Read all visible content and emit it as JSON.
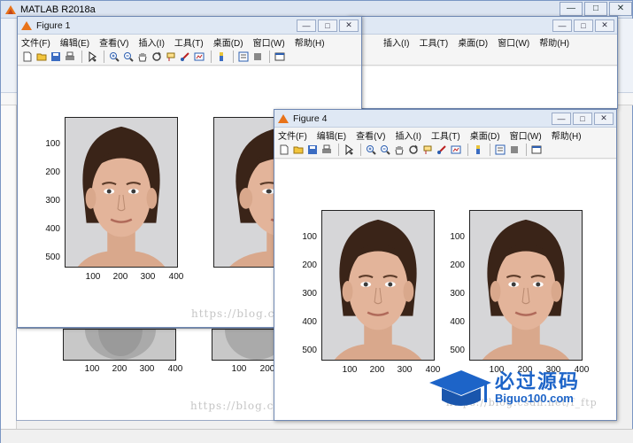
{
  "matlab": {
    "title": "MATLAB R2018a",
    "controls": {
      "minimize": "—",
      "maximize": "□",
      "close": "✕"
    }
  },
  "figures": [
    {
      "id": "figure1",
      "title": "Figure 1",
      "menus": [
        "文件(F)",
        "编辑(E)",
        "查看(V)",
        "插入(I)",
        "工具(T)",
        "桌面(D)",
        "窗口(W)",
        "帮助(H)"
      ],
      "y_ticks": [
        "100",
        "200",
        "300",
        "400",
        "500"
      ],
      "x_ticks": [
        "100",
        "200",
        "300",
        "400"
      ],
      "x_ticks_right_partial": [
        "100",
        "200"
      ]
    },
    {
      "id": "figure4",
      "title": "Figure 4",
      "menus": [
        "文件(F)",
        "编辑(E)",
        "查看(V)",
        "插入(I)",
        "工具(T)",
        "桌面(D)",
        "窗口(W)",
        "帮助(H)"
      ],
      "y_ticks": [
        "100",
        "200",
        "300",
        "400",
        "500"
      ],
      "x_ticks": [
        "100",
        "200",
        "300",
        "400"
      ],
      "y_ticks_right": [
        "100",
        "200",
        "300",
        "400",
        "500"
      ],
      "x_ticks_right": [
        "100",
        "200",
        "300",
        "400"
      ]
    },
    {
      "id": "figure-back",
      "menus": [
        "插入(I)",
        "工具(T)",
        "桌面(D)",
        "窗口(W)",
        "帮助(H)"
      ]
    }
  ],
  "behind_axes": {
    "x_ticks_left": [
      "100",
      "200",
      "300",
      "400"
    ],
    "x_ticks_right": [
      "100",
      "200"
    ]
  },
  "watermarks": {
    "url1": "https://blog.c",
    "url2": "https://blog.c",
    "url3": "https://blog.csdn.net/f_ftp"
  },
  "brand": {
    "cn": "必过源码",
    "en": "Biguo100.com"
  },
  "icons": [
    "new-file-icon",
    "open-folder-icon",
    "save-icon",
    "print-icon",
    "pointer-icon",
    "zoom-in-icon",
    "zoom-out-icon",
    "pan-hand-icon",
    "rotate-icon",
    "data-cursor-icon",
    "brush-icon",
    "link-plot-icon",
    "colorbar-icon",
    "legend-icon",
    "hide-tools-icon",
    "dock-icon"
  ]
}
